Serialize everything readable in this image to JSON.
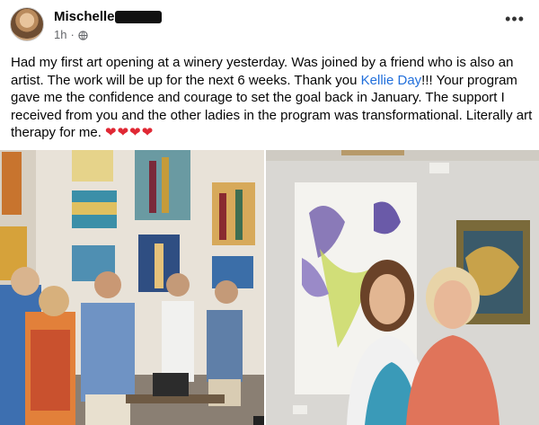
{
  "post": {
    "author_name": "Mischelle",
    "timestamp": "1h",
    "privacy_icon": "globe-icon",
    "more_icon": "more-options-icon",
    "more_label": "•••",
    "text_before_mention": "Had my first art opening at a winery yesterday.  Was joined by a friend who is also an artist. The work will be up for the next 6 weeks. Thank you ",
    "mention": "Kellie Day",
    "text_after_mention": "!!!  Your program gave me the confidence and courage to set the goal back in January. The support I received from you and the other ladies in the program was transformational. Literally art therapy for me. ",
    "hearts": "❤❤❤❤"
  },
  "colors": {
    "mention": "#216fdb",
    "meta_text": "#65676b",
    "heart": "#e02834"
  },
  "photos": [
    {
      "name": "gallery-crowd-photo"
    },
    {
      "name": "two-women-artwork-photo"
    }
  ]
}
